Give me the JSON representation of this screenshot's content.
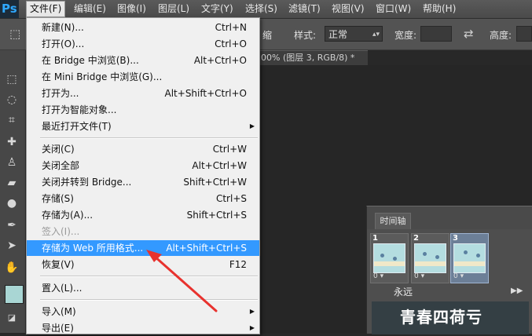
{
  "app": {
    "logo": "Ps"
  },
  "menubar": {
    "items": [
      "文件(F)",
      "编辑(E)",
      "图像(I)",
      "图层(L)",
      "文字(Y)",
      "选择(S)",
      "滤镜(T)",
      "视图(V)",
      "窗口(W)",
      "帮助(H)"
    ]
  },
  "options": {
    "partial_label": "缩",
    "style_label": "样式:",
    "style_value": "正常",
    "width_label": "宽度:",
    "height_label": "高度:"
  },
  "document_tab": {
    "title": "00% (图层 3, RGB/8) *"
  },
  "file_menu": {
    "items": [
      {
        "label": "新建(N)...",
        "shortcut": "Ctrl+N"
      },
      {
        "label": "打开(O)...",
        "shortcut": "Ctrl+O"
      },
      {
        "label": "在 Bridge 中浏览(B)...",
        "shortcut": "Alt+Ctrl+O"
      },
      {
        "label": "在 Mini Bridge 中浏览(G)...",
        "shortcut": ""
      },
      {
        "label": "打开为...",
        "shortcut": "Alt+Shift+Ctrl+O"
      },
      {
        "label": "打开为智能对象...",
        "shortcut": ""
      },
      {
        "label": "最近打开文件(T)",
        "shortcut": ""
      },
      {
        "label": "关闭(C)",
        "shortcut": "Ctrl+W"
      },
      {
        "label": "关闭全部",
        "shortcut": "Alt+Ctrl+W"
      },
      {
        "label": "关闭并转到 Bridge...",
        "shortcut": "Shift+Ctrl+W"
      },
      {
        "label": "存储(S)",
        "shortcut": "Ctrl+S"
      },
      {
        "label": "存储为(A)...",
        "shortcut": "Shift+Ctrl+S"
      },
      {
        "label": "签入(I)...",
        "shortcut": ""
      },
      {
        "label": "存储为 Web 所用格式...",
        "shortcut": "Alt+Shift+Ctrl+S"
      },
      {
        "label": "恢复(V)",
        "shortcut": "F12"
      },
      {
        "label": "置入(L)...",
        "shortcut": ""
      },
      {
        "label": "导入(M)",
        "shortcut": ""
      },
      {
        "label": "导出(E)",
        "shortcut": ""
      }
    ]
  },
  "timeline": {
    "tab_label": "时间轴",
    "frames": [
      {
        "number": "1",
        "time": "0 ▾"
      },
      {
        "number": "2",
        "time": "0 ▾"
      },
      {
        "number": "3",
        "time": "0 ▾"
      }
    ],
    "loop_label": "永远",
    "strip_text": "青春四荷亏"
  },
  "colors": {
    "highlight": "#3399ff",
    "annotation_arrow": "#e8322e",
    "foreground_swatch": "#a9d6d4"
  }
}
